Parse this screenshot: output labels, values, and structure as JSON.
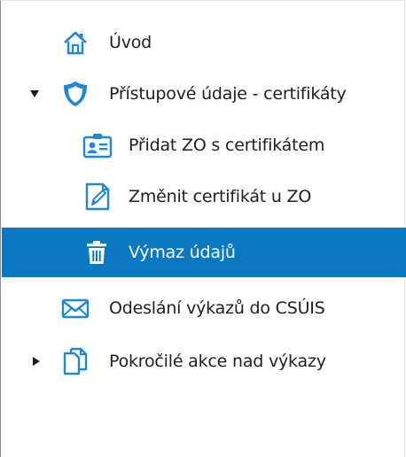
{
  "tree": {
    "items": [
      {
        "label": "Úvod",
        "icon": "home-icon"
      },
      {
        "label": "Přístupové údaje - certifikáty",
        "icon": "shield-icon",
        "expander": "expanded"
      },
      {
        "label": "Přidat ZO s certifikátem",
        "icon": "id-card-icon"
      },
      {
        "label": "Změnit certifikát u ZO",
        "icon": "edit-document-icon"
      },
      {
        "label": "Výmaz údajů",
        "icon": "trash-icon",
        "selected": true
      },
      {
        "label": "Odeslání výkazů do CSÚIS",
        "icon": "envelope-icon"
      },
      {
        "label": "Pokročilé akce nad výkazy",
        "icon": "documents-icon",
        "expander": "collapsed"
      }
    ]
  },
  "colors": {
    "selection": "#0a79c2",
    "icon_blue": "#1e88d6",
    "text": "#1e1e1e"
  }
}
